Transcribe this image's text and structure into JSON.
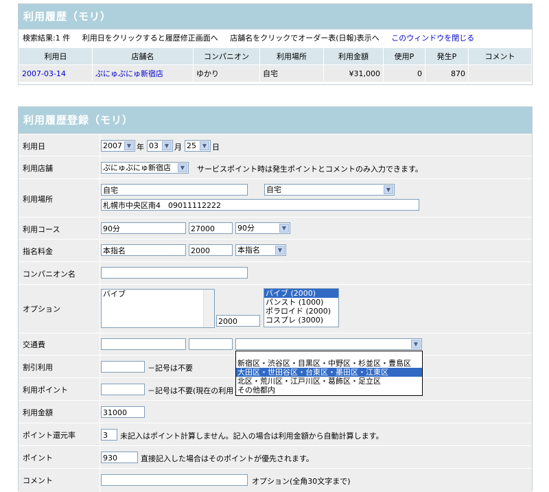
{
  "history": {
    "title": "利用履歴（モリ）",
    "info": {
      "result": "検索結果:1 件",
      "hint1": "利用日をクリックすると履歴修正画面へ",
      "hint2": "店舗名をクリックでオーダー表(日報)表示へ",
      "close_link": "このウィンドウを閉じる"
    },
    "columns": [
      "利用日",
      "店舗名",
      "コンパニオン",
      "利用場所",
      "利用金額",
      "使用P",
      "発生P",
      "コメント"
    ],
    "rows": [
      {
        "date": "2007-03-14",
        "store": "ぷにゅぷにゅ新宿店",
        "companion": "ゆかり",
        "place": "自宅",
        "amount": "¥31,000",
        "used_p": "0",
        "earned_p": "870",
        "comment": ""
      }
    ]
  },
  "register": {
    "title": "利用履歴登録（モリ）",
    "labels": {
      "date": "利用日",
      "store": "利用店舗",
      "place": "利用場所",
      "course": "利用コース",
      "nomination": "指名料金",
      "companion": "コンパニオン名",
      "option": "オプション",
      "transport": "交通費",
      "discount": "割引利用",
      "point_use": "利用ポイント",
      "amount": "利用金額",
      "rate": "ポイント還元率",
      "point": "ポイント",
      "comment": "コメント"
    },
    "date": {
      "year": "2007",
      "year_unit": "年",
      "month": "03",
      "month_unit": "月",
      "day": "25",
      "day_unit": "日"
    },
    "store": {
      "selected": "ぷにゅぷにゅ新宿店",
      "note": "サービスポイント時は発生ポイントとコメントのみ入力できます。"
    },
    "place": {
      "name": "自宅",
      "select": "自宅",
      "address": "札幌市中央区南4　09011112222"
    },
    "course": {
      "name": "90分",
      "price": "27000",
      "select": "90分"
    },
    "nomination": {
      "name": "本指名",
      "price": "2000",
      "select": "本指名"
    },
    "companion": {
      "value": ""
    },
    "option": {
      "text": "バイブ",
      "price": "2000",
      "list": [
        "バイブ (2000)",
        "パンスト (1000)",
        "ポラロイド (2000)",
        "コスプレ (3000)"
      ],
      "selected_index": 0
    },
    "transport": {
      "dropdown": [
        "新宿区・渋谷区・目黒区・中野区・杉並区・豊島区",
        "大田区・世田谷区・台東区・墨田区・江東区",
        "北区・荒川区・江戸川区・葛飾区・足立区",
        "その他都内"
      ],
      "highlight_index": 1
    },
    "discount": {
      "note": "－記号は不要"
    },
    "point_use": {
      "note": "－記号は不要(現在の利用"
    },
    "amount": {
      "value": "31000"
    },
    "rate": {
      "value": "3",
      "note": "未記入はポイント計算しません。記入の場合は利用金額から自動計算します。"
    },
    "point": {
      "value": "930",
      "note": "直接記入した場合はそのポイントが優先されます。"
    },
    "comment": {
      "note": "オプション(全角30文字まで)"
    }
  }
}
